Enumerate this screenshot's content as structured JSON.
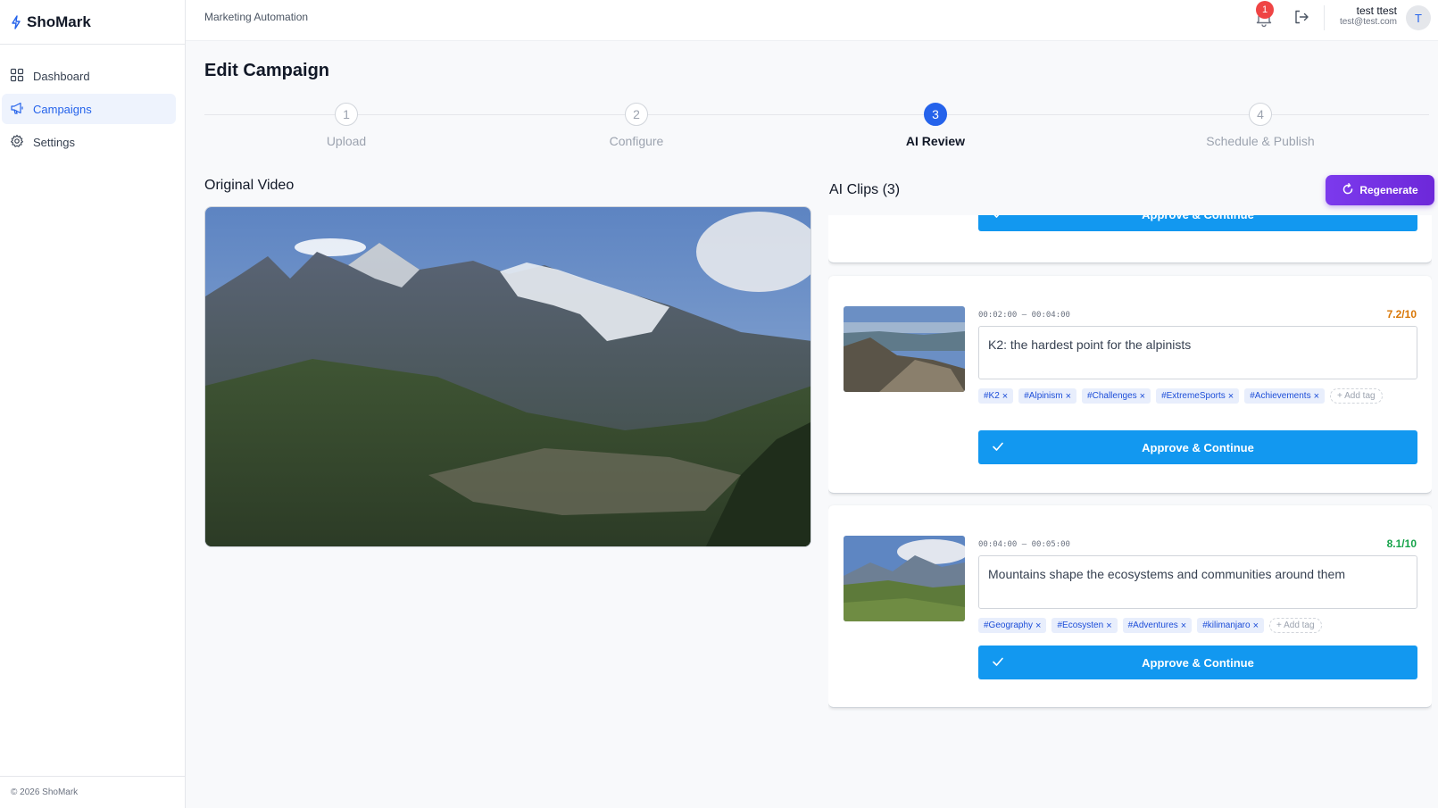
{
  "app": {
    "name": "ShoMark",
    "footer": "© 2026 ShoMark"
  },
  "sidebar": {
    "items": [
      {
        "label": "Dashboard",
        "icon": "grid-icon"
      },
      {
        "label": "Campaigns",
        "icon": "megaphone-icon",
        "active": true
      },
      {
        "label": "Settings",
        "icon": "gear-icon"
      }
    ]
  },
  "header": {
    "section": "Marketing Automation",
    "notifications": "1",
    "user": {
      "name": "test ttest",
      "email": "test@test.com",
      "initial": "T"
    }
  },
  "page": {
    "title": "Edit Campaign"
  },
  "stepper": {
    "steps": [
      {
        "number": "1",
        "label": "Upload"
      },
      {
        "number": "2",
        "label": "Configure"
      },
      {
        "number": "3",
        "label": "AI Review",
        "active": true
      },
      {
        "number": "4",
        "label": "Schedule & Publish"
      }
    ]
  },
  "original": {
    "title": "Original Video"
  },
  "clips": {
    "title": "AI Clips (3)",
    "regenerate_label": "Regenerate",
    "approve_label": "Approve & Continue",
    "add_tag_label": "+ Add tag",
    "items": [
      {
        "time": "00:02:00 – 00:04:00",
        "score": "7.2/10",
        "score_color": "#d97706",
        "caption": "K2: the hardest point for the alpinists",
        "tags": [
          "#K2",
          "#Alpinism",
          "#Challenges",
          "#ExtremeSports",
          "#Achievements"
        ]
      },
      {
        "time": "00:04:00 – 00:05:00",
        "score": "8.1/10",
        "score_color": "#16a34a",
        "caption": "Mountains shape the ecosystems and communities around them",
        "tags": [
          "#Geography",
          "#Ecosysten",
          "#Adventures",
          "#kilimanjaro"
        ]
      }
    ]
  },
  "colors": {
    "accent": "#2563eb",
    "approve": "#1298f0",
    "regenerate": "#7c3aed"
  }
}
